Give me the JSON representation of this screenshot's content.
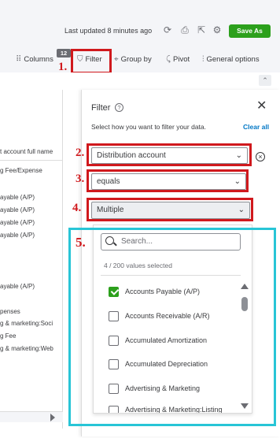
{
  "topbar": {
    "last_updated": "Last updated 8 minutes ago",
    "icons": [
      "refresh-icon",
      "print-icon",
      "export-icon",
      "settings-icon"
    ],
    "save_as_label": "Save As",
    "accent": "#2ca01c"
  },
  "toolbar": {
    "columns_label": "Columns",
    "columns_count": "12",
    "filter_label": "Filter",
    "group_by_label": "Group by",
    "pivot_label": "Pivot",
    "general_options_label": "General options"
  },
  "report": {
    "header": "t account full name",
    "rows": [
      "g Fee/Expense",
      "ayable (A/P)",
      "ayable (A/P)",
      "ayable (A/P)",
      "ayable (A/P)",
      "ayable (A/P)",
      "penses",
      "g & marketing:Soci",
      "g Fee",
      "g & marketing:Web"
    ]
  },
  "filter_panel": {
    "title": "Filter",
    "subtitle": "Select how you want to filter your data.",
    "clear_all": "Clear all",
    "field": "Distribution account",
    "operator": "equals",
    "value_mode": "Multiple",
    "search_placeholder": "Search...",
    "selected_count": "4 / 200 values selected",
    "options": [
      {
        "label": "Accounts Payable (A/P)",
        "checked": true
      },
      {
        "label": "Accounts Receivable (A/R)",
        "checked": false
      },
      {
        "label": "Accumulated Amortization",
        "checked": false
      },
      {
        "label": "Accumulated Depreciation",
        "checked": false
      },
      {
        "label": "Advertising & Marketing",
        "checked": false
      },
      {
        "label": "Advertising & Marketing:Listing",
        "checked": false
      }
    ]
  },
  "annotations": {
    "step1": "1.",
    "step2": "2.",
    "step3": "3.",
    "step4": "4.",
    "step5": "5.",
    "red": "#d0191d",
    "teal": "#28c5d6"
  }
}
